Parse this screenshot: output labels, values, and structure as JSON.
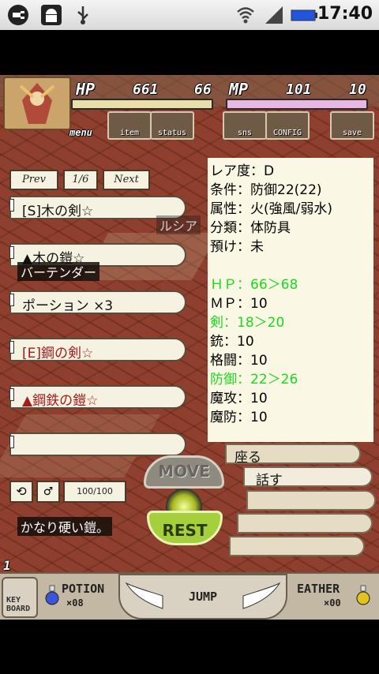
{
  "status_bar": {
    "time": "17:40"
  },
  "hud": {
    "hp_label": "HP",
    "hp_value": "661",
    "hp_max": "66",
    "mp_label": "MP",
    "mp_value": "101",
    "mp_max": "10",
    "menu_label": "menu",
    "buttons": [
      "item",
      "status",
      "sns",
      "CONFIG",
      "save"
    ]
  },
  "nav": {
    "prev": "Prev",
    "page": "1/6",
    "next": "Next"
  },
  "items": [
    {
      "label": "[S]木の剣☆",
      "color": "#111111"
    },
    {
      "label": "▲木の鎧☆",
      "color": "#111111"
    },
    {
      "label": "ポーション ×3",
      "color": "#111111"
    },
    {
      "label": "[E]鋼の剣☆",
      "color": "#a41b1b"
    },
    {
      "label": "▲鋼鉄の鎧☆",
      "color": "#a41b1b"
    },
    {
      "label": "",
      "color": "#111111"
    }
  ],
  "npc_labels": {
    "lucia": "ルシア",
    "bartender": "バーテンダー"
  },
  "info": {
    "rarity": "レア度：D",
    "condition": "条件：防御22(22)",
    "attribute": "属性：火(強風/弱水)",
    "category": "分類：体防具",
    "deposit": "預け：未",
    "hp": "ＨＰ：66＞68",
    "mp": "ＭＰ：10",
    "sword": "剣：18＞20",
    "gun": "銃：10",
    "fight": "格闘：10",
    "defense": "防御：22＞26",
    "mag_atk": "魔攻：10",
    "mag_def": "魔防：10"
  },
  "actions": {
    "sit": "座る",
    "talk": "話す",
    "move": "MOVE",
    "rest": "REST"
  },
  "counter": "100/100",
  "description": "かなり硬い鎧。",
  "level_indicator": "1",
  "bottom": {
    "keyboard": "KEY BOARD",
    "potion": "POTION",
    "potion_count": "×08",
    "jump": "JUMP",
    "feather": "EATHER",
    "feather_count": "×00"
  },
  "colors": {
    "accent_green": "#1dd81d",
    "item_red": "#a41b1b"
  }
}
